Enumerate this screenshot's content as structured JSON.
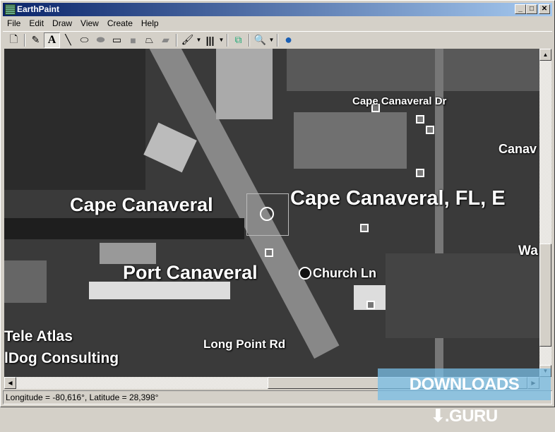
{
  "window": {
    "title": "EarthPaint",
    "minimize": "_",
    "maximize": "□",
    "close": "✕"
  },
  "menu": [
    "File",
    "Edit",
    "Draw",
    "View",
    "Create",
    "Help"
  ],
  "toolbar": [
    {
      "name": "new-document",
      "glyph": "🗋"
    },
    {
      "name": "pencil",
      "glyph": "✎"
    },
    {
      "name": "text",
      "glyph": "A"
    },
    {
      "name": "line",
      "glyph": "╲"
    },
    {
      "name": "ellipse",
      "glyph": "⬭"
    },
    {
      "name": "filled-ellipse",
      "glyph": "⬬"
    },
    {
      "name": "rectangle",
      "glyph": "▭"
    },
    {
      "name": "filled-rectangle",
      "glyph": "■"
    },
    {
      "name": "polygon",
      "glyph": "⏢"
    },
    {
      "name": "filled-polygon",
      "glyph": "▰"
    },
    {
      "name": "pen-color",
      "glyph": "🖌"
    },
    {
      "name": "line-width",
      "glyph": "|||"
    },
    {
      "name": "layers",
      "glyph": "⧉"
    },
    {
      "name": "zoom",
      "glyph": "🔍"
    },
    {
      "name": "google-earth",
      "glyph": "●"
    }
  ],
  "map": {
    "labels": [
      "Cape Canaveral Dr",
      "Canav",
      "Cape Canaveral",
      "Cape Canaveral, FL, E",
      "Wa",
      "Port Canaveral",
      "Church Ln",
      "Tele Atlas",
      "lDog Consulting",
      "Long Point Rd"
    ]
  },
  "status": "Longitude = -80,616°, Latitude = 28,398°",
  "watermark": "DOWNLOADS ⬇.GURU"
}
